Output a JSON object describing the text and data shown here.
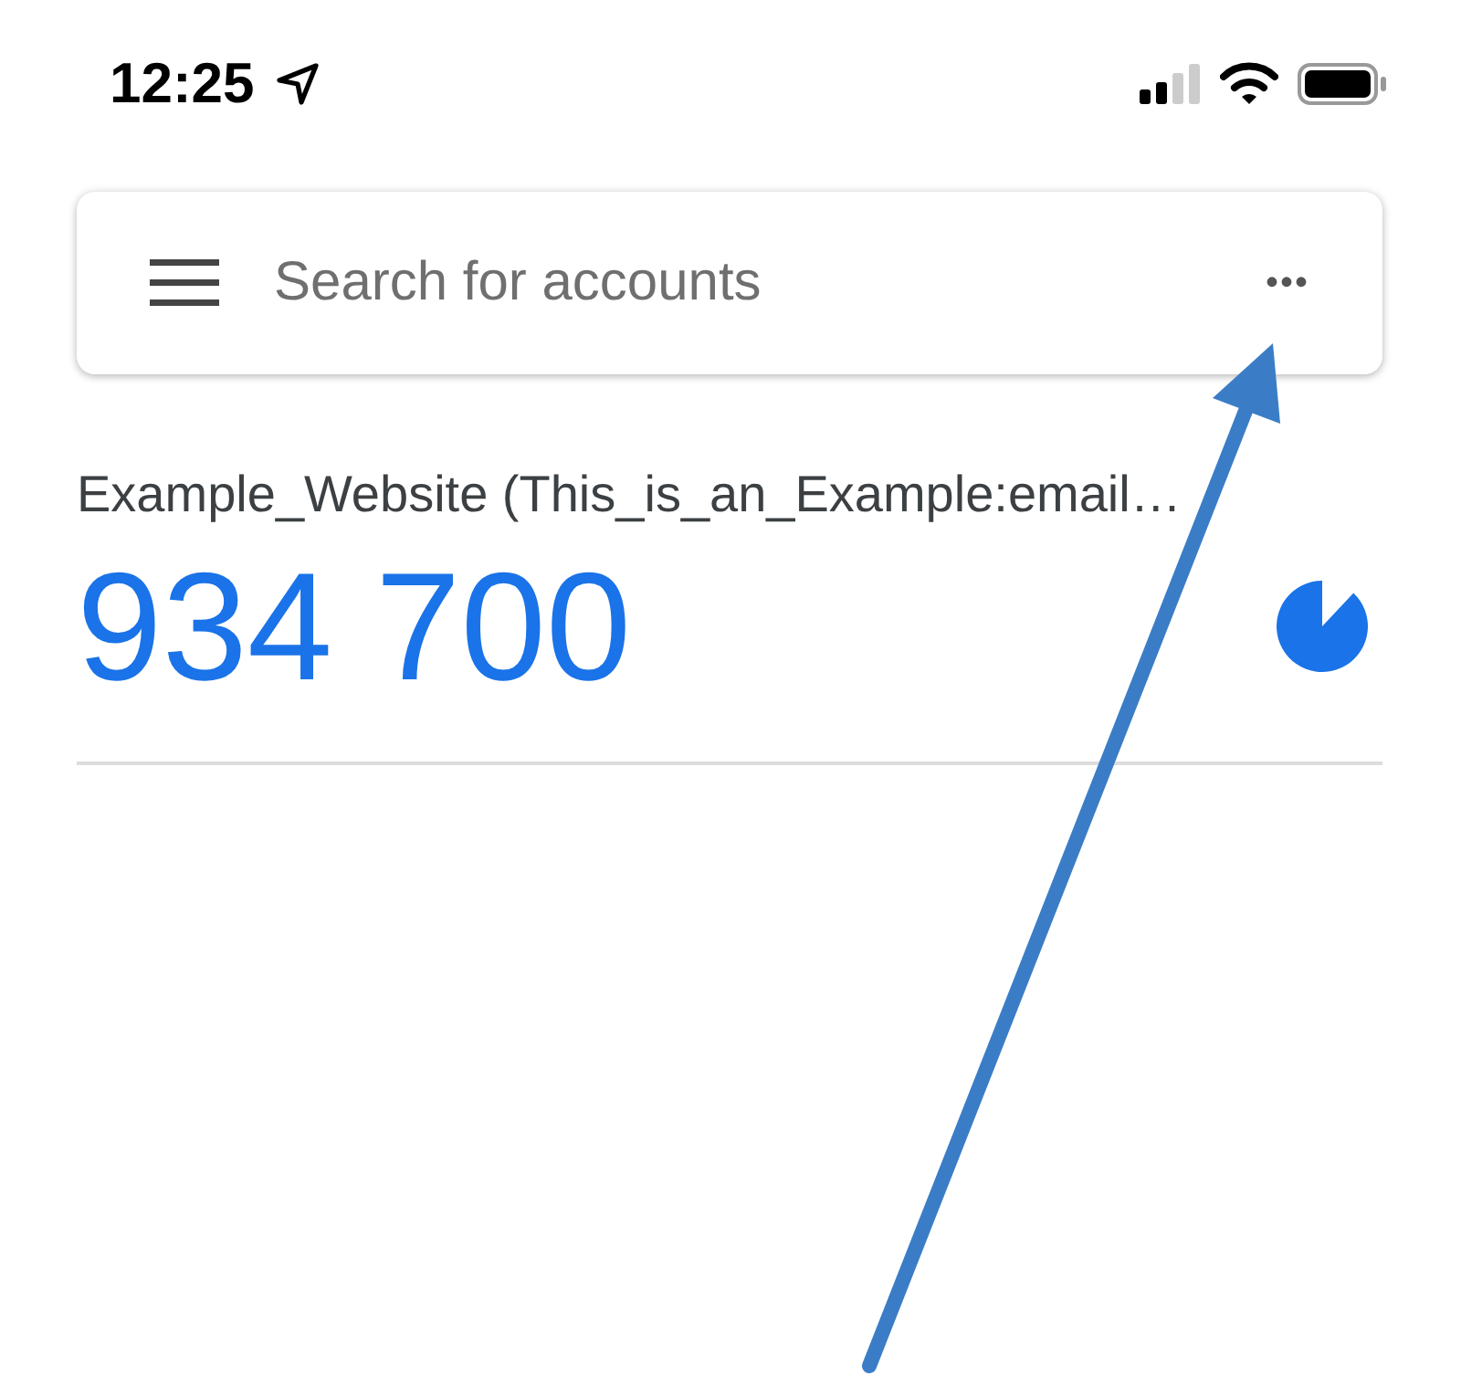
{
  "status_bar": {
    "time": "12:25"
  },
  "search": {
    "placeholder": "Search for accounts",
    "more": "•••"
  },
  "accounts": [
    {
      "name": "Example_Website (This_is_an_Example:email…",
      "code": "934 700"
    }
  ]
}
